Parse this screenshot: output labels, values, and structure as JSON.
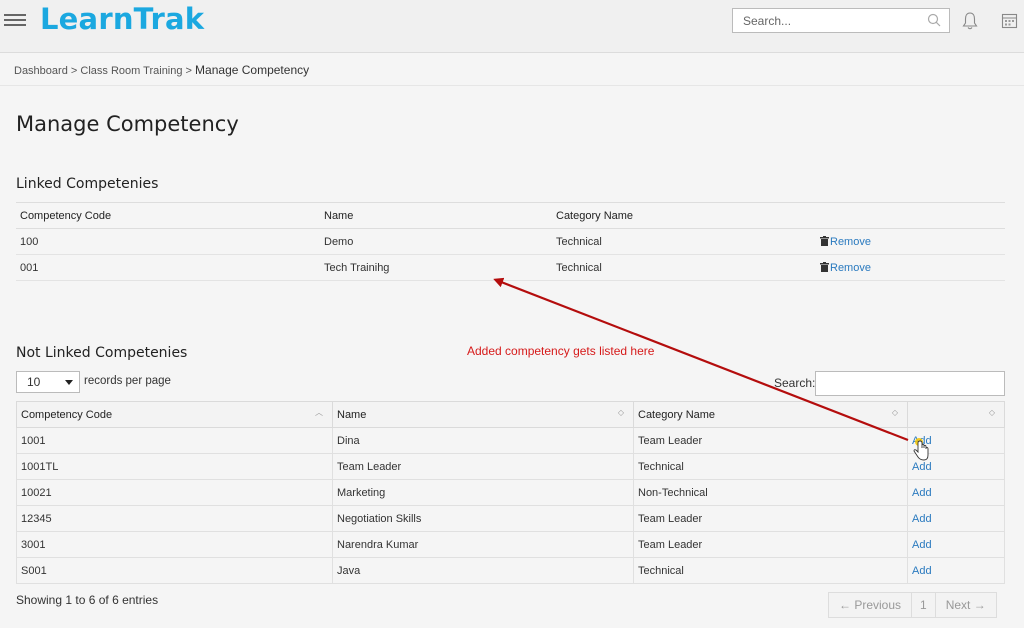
{
  "header": {
    "logo": "LearnTrak",
    "search_placeholder": "Search..."
  },
  "breadcrumb": {
    "items": [
      "Dashboard",
      "Class Room Training"
    ],
    "current": "Manage Competency",
    "separator": ">"
  },
  "page_title": "Manage Competency",
  "linked": {
    "title": "Linked Competenies",
    "columns": [
      "Competency Code",
      "Name",
      "Category Name"
    ],
    "rows": [
      {
        "code": "100",
        "name": "Demo",
        "category": "Technical",
        "action": "Remove"
      },
      {
        "code": "001",
        "name": "Tech Trainihg",
        "category": "Technical",
        "action": "Remove"
      }
    ]
  },
  "not_linked": {
    "title": "Not Linked Competenies",
    "length_value": "10",
    "length_label": "records per page",
    "search_label": "Search:",
    "columns": [
      "Competency Code",
      "Name",
      "Category Name"
    ],
    "rows": [
      {
        "code": "1001",
        "name": "Dina",
        "category": "Team Leader",
        "action": "Add"
      },
      {
        "code": "1001TL",
        "name": "Team Leader",
        "category": "Technical",
        "action": "Add"
      },
      {
        "code": "10021",
        "name": "Marketing",
        "category": "Non-Technical",
        "action": "Add"
      },
      {
        "code": "12345",
        "name": "Negotiation Skills",
        "category": "Team Leader",
        "action": "Add"
      },
      {
        "code": "3001",
        "name": "Narendra Kumar",
        "category": "Team Leader",
        "action": "Add"
      },
      {
        "code": "S001",
        "name": "Java",
        "category": "Technical",
        "action": "Add"
      }
    ],
    "info": "Showing 1 to 6 of 6 entries",
    "pager": {
      "previous": "← Previous",
      "page": "1",
      "next": "Next →"
    }
  },
  "annotation": "Added competency gets listed here",
  "colors": {
    "brand": "#1ba8e0",
    "link": "#2a7abf",
    "annotation": "#d61a1a"
  }
}
